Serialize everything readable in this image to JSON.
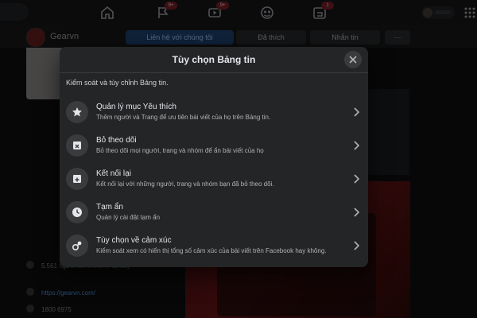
{
  "topbar": {
    "badges": {
      "flag": "9+",
      "video": "9+",
      "gaming": "1"
    }
  },
  "page": {
    "name": "Gearvn",
    "buttons": {
      "contact": "Liên hệ với chúng tôi",
      "liked": "Đã thích",
      "message": "Nhắn tin",
      "more": "···"
    },
    "left_info": {
      "checkin": "5.561 người đã check in tại đây",
      "website": "https://gearvn.com/",
      "phone": "1800 6975"
    }
  },
  "modal": {
    "title": "Tùy chọn Bảng tin",
    "description": "Kiểm soát và tùy chỉnh Bảng tin.",
    "options": [
      {
        "icon": "star-icon",
        "title": "Quản lý mục Yêu thích",
        "subtitle": "Thêm người và Trang để ưu tiên bài viết của họ trên Bảng tin."
      },
      {
        "icon": "unfollow-icon",
        "title": "Bỏ theo dõi",
        "subtitle": "Bỏ theo dõi mọi người, trang và nhóm để ẩn bài viết của họ"
      },
      {
        "icon": "reconnect-icon",
        "title": "Kết nối lại",
        "subtitle": "Kết nối lại với những người, trang và nhóm bạn đã bỏ theo dõi."
      },
      {
        "icon": "clock-icon",
        "title": "Tạm ẩn",
        "subtitle": "Quản lý cài đặt tạm ẩn"
      },
      {
        "icon": "reaction-icon",
        "title": "Tùy chọn về cảm xúc",
        "subtitle": "Kiểm soát xem có hiển thị tổng số cảm xúc của bài viết trên Facebook hay không."
      }
    ]
  }
}
